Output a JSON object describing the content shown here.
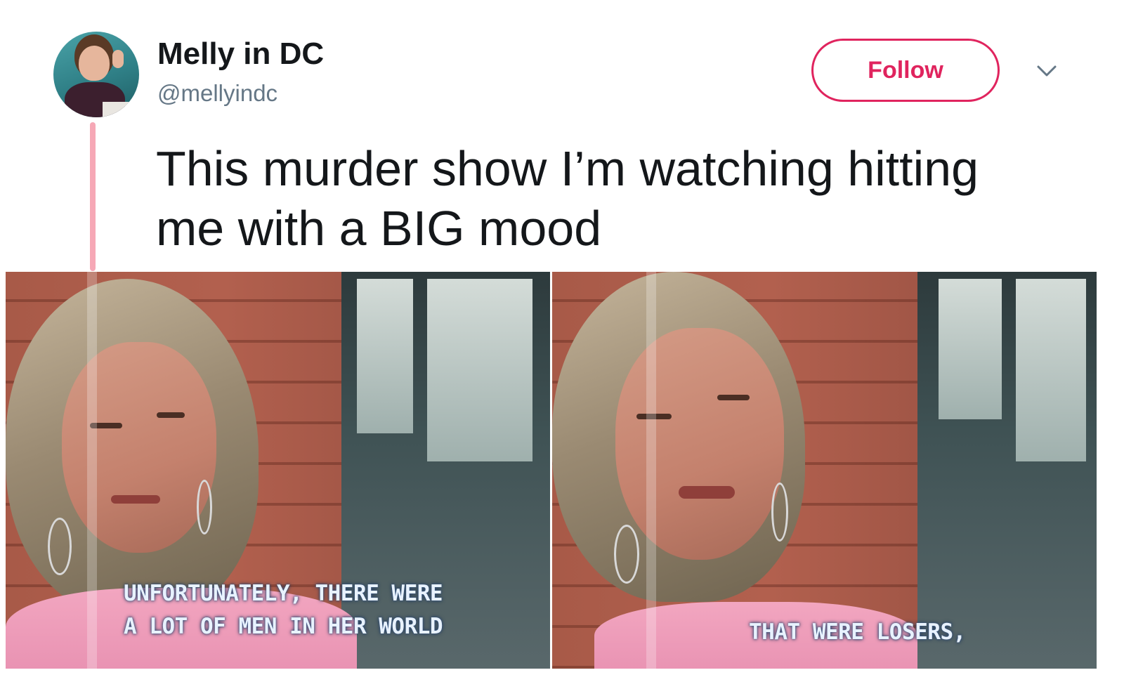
{
  "tweet": {
    "display_name": "Melly in DC",
    "handle": "@mellyindc",
    "follow_label": "Follow",
    "text": "This murder show I’m watching hitting\nme with a BIG mood"
  },
  "media": [
    {
      "caption_line_1": "UNFORTUNATELY, THERE WERE",
      "caption_line_2": "A LOT OF MEN IN HER WORLD"
    },
    {
      "caption_line_1": "THAT WERE LOSERS,"
    }
  ],
  "colors": {
    "accent": "#e0245e",
    "thread_line": "#f6a8b6",
    "handle": "#657786",
    "text": "#14171a"
  },
  "icons": {
    "menu": "chevron-down-icon"
  }
}
